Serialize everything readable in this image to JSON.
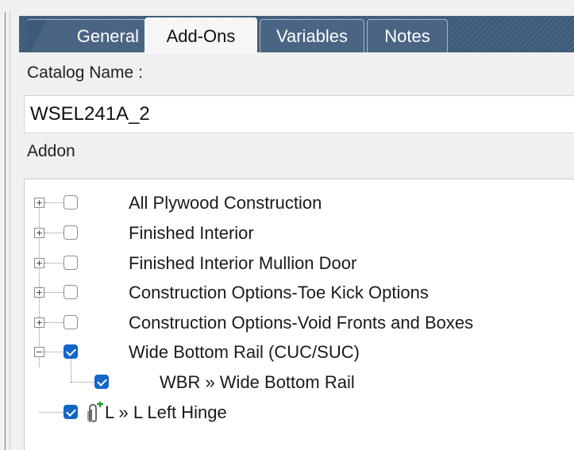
{
  "tabs": [
    {
      "label": "General",
      "active": false
    },
    {
      "label": "Add-Ons",
      "active": true
    },
    {
      "label": "Variables",
      "active": false
    },
    {
      "label": "Notes",
      "active": false
    }
  ],
  "catalog": {
    "label": "Catalog Name :",
    "value": "WSEL241A_2"
  },
  "addon": {
    "label": "Addon"
  },
  "tree_items": [
    {
      "label": "All Plywood Construction",
      "checked": false,
      "expander": "collapsed",
      "level": 0
    },
    {
      "label": "Finished Interior",
      "checked": false,
      "expander": "collapsed",
      "level": 0
    },
    {
      "label": "Finished Interior Mullion Door",
      "checked": false,
      "expander": "collapsed",
      "level": 0
    },
    {
      "label": "Construction Options-Toe Kick Options",
      "checked": false,
      "expander": "collapsed",
      "level": 0
    },
    {
      "label": "Construction Options-Void Fronts and Boxes",
      "checked": false,
      "expander": "collapsed",
      "level": 0
    },
    {
      "label": "Wide Bottom Rail (CUC/SUC)",
      "checked": true,
      "expander": "expanded",
      "level": 0
    },
    {
      "label": "WBR » Wide Bottom Rail",
      "checked": true,
      "expander": "none",
      "level": 1
    },
    {
      "label": "L » L Left Hinge",
      "checked": true,
      "expander": "none",
      "level": 0,
      "icon": "hinge-clip-icon"
    }
  ],
  "colors": {
    "tab_background": "#3d5a7a",
    "tab_inactive": "#4a6584",
    "checkbox_checked": "#1366c9",
    "clip_icon_plus": "#1e9a2a"
  }
}
